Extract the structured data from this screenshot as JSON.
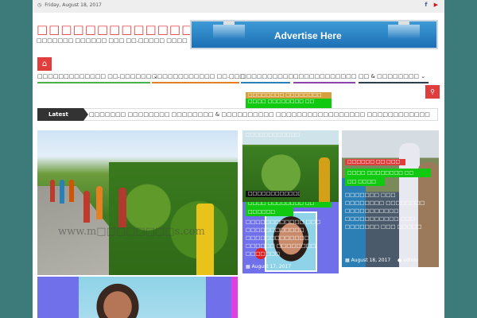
{
  "topbar": {
    "date": "Friday, August 18, 2017",
    "social": [
      "f",
      "▶"
    ]
  },
  "header": {
    "logo": "□□□□□□□□□□□□□",
    "tagline": "□□□□□□□ □□□□□□ □□□ □□.□□□□□ □□□□",
    "ad_text": "Advertise Here"
  },
  "nav": {
    "home_icon": "home-icon",
    "items": [
      "□□□□□□□□□□□□□ □□.□□□□□□ ⌄",
      "□□□□□□□□□□□□ □□.□□□",
      "□□□□□□□□□□",
      "□□□□□□□□□□□□",
      "□□ & □□□□□□□□ ⌄"
    ],
    "dropdown": [
      "□□□□□□□□ □□□□□□□□",
      "□□□□ □□□□□□□□ □□"
    ],
    "search_icon": "search-icon"
  },
  "latest": {
    "label": "Latest",
    "ticker": "□□□□□□□ □□□□□□□□ □□□□□□□□ & □□□□□□□□□□ □□□□□□□□□□□□□□□□□ □□□□□□□□□□□□"
  },
  "posts": {
    "main": {
      "watermark": "www.m□□□□□□□□s.com"
    },
    "p2": {
      "text": "□□□□□□□□□□□□"
    },
    "p3": {
      "category": "□□□□□□□□□□□□",
      "label": "□□□□ □□□□□□□□ □□",
      "label2": "□□□□□□",
      "text": "□□□□□□□□□□□□ □□□ □□□□□□□□□□□□ □□□□□□□□□□□□□ □□□□□□ □□□□□□□□ □□□□□□□",
      "date": "August 17, 2017"
    },
    "p4": {
      "category": "□□□□□□ □□ □□□",
      "label": "□□□□ □□□□□□□□ □□",
      "label2": "□□ □□□□",
      "text": "□□□□□□□ □□□ □□□□□□□□ □□□□□□□□ □□□□□□□□□□□ □□□□□□□□□□□.□□□ □□□□□□□ □□□ □□□□□",
      "date": "August 18, 2017",
      "author": "admin"
    }
  }
}
